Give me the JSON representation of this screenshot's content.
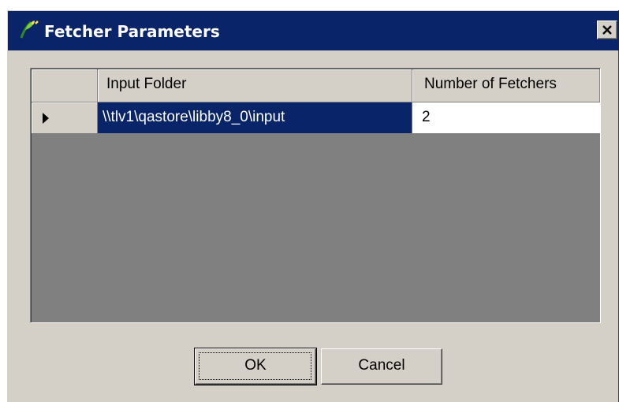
{
  "window": {
    "title": "Fetcher Parameters",
    "icon": "app-leaf-icon",
    "close_icon": "close-icon"
  },
  "grid": {
    "columns": [
      "Input Folder",
      "Number of Fetchers"
    ],
    "rows": [
      {
        "indicator": "current-row-arrow-icon",
        "input_folder": "\\\\tlv1\\qastore\\libby8_0\\input",
        "number_of_fetchers": "2"
      }
    ]
  },
  "buttons": {
    "ok": "OK",
    "cancel": "Cancel"
  },
  "colors": {
    "title_bar": "#0a246a",
    "dialog_face": "#d4d0c8",
    "grid_background": "#808080",
    "selected_cell": "#0a246a"
  }
}
